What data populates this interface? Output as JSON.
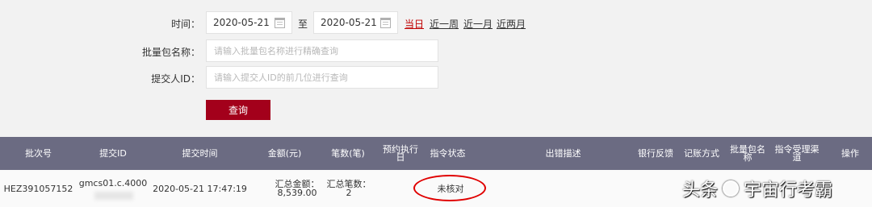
{
  "filters": {
    "time_label": "时间：",
    "start_date": "2020-05-21",
    "to_label": "至",
    "end_date": "2020-05-21",
    "quick_ranges": [
      "当日",
      "近一周",
      "近一月",
      "近两月"
    ],
    "batch_label": "批量包名称：",
    "batch_placeholder": "请输入批量包名称进行精确查询",
    "submitter_label": "提交人ID：",
    "submitter_placeholder": "请输入提交人ID的前几位进行查询",
    "query_button": "查询"
  },
  "table": {
    "headers": [
      "批次号",
      "提交ID",
      "提交时间",
      "金额(元)",
      "笔数(笔)",
      "预约执行日",
      "指令状态",
      "出错描述",
      "银行反馈",
      "记账方式",
      "批量包名称",
      "指令受理渠道",
      "操作"
    ],
    "row": {
      "batch_no": "HEZ391057152",
      "submit_id": "gmcs01.c.4000",
      "submit_time": "2020-05-21 17:47:19",
      "amount_label": "汇总金额：",
      "amount_value": "8,539.00",
      "count_label": "汇总笔数：",
      "count_value": "2",
      "status": "未核对"
    }
  },
  "watermark": {
    "text_left": "头条",
    "text_right": "宇宙行考霸"
  },
  "colors": {
    "header_bg": "#6b6b82",
    "button_bg": "#a3001b",
    "active_link": "#c00000",
    "circle": "#e00000"
  }
}
